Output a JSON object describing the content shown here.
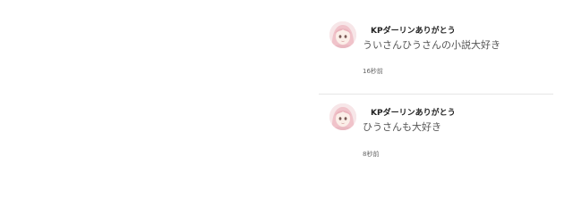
{
  "comments": [
    {
      "author": "KPダーリンありがとう",
      "body": "ういさんひうさんの小説大好き",
      "time": "16秒前",
      "avatar_icon": "anime-girl-avatar-icon"
    },
    {
      "author": "KPダーリンありがとう",
      "body": "ひうさんも大好き",
      "time": "8秒前",
      "avatar_icon": "anime-girl-avatar-icon"
    }
  ],
  "colors": {
    "avatar_hair": "#f2c9cf",
    "avatar_skin": "#fbeee8",
    "divider": "#e6e6e6"
  }
}
